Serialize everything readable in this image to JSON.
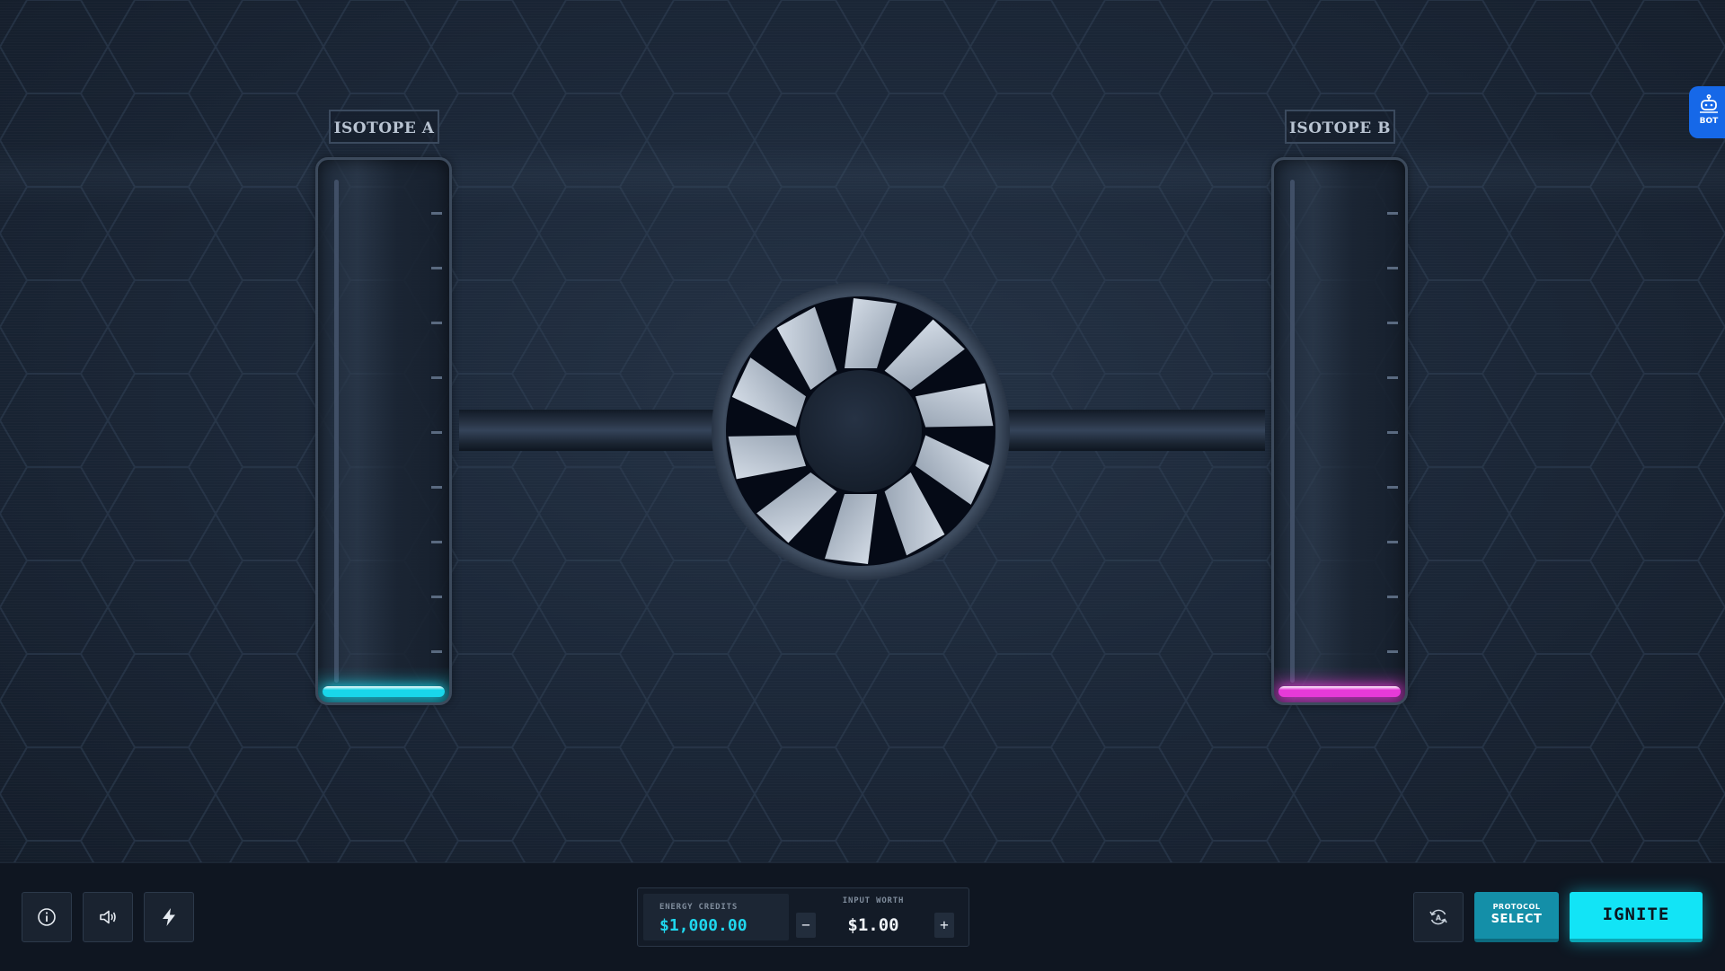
{
  "isotopes": [
    {
      "label": "ISOTOPE A",
      "color": "#19d6ea",
      "level": 0.0
    },
    {
      "label": "ISOTOPE B",
      "color": "#e63ad8",
      "level": 0.0
    }
  ],
  "bot_tab": {
    "label": "BOT",
    "icon": "robot-icon"
  },
  "bottom_bar": {
    "info_icon": "info-icon",
    "sound_icon": "speaker-icon",
    "turbo_icon": "lightning-icon",
    "credits": {
      "label": "ENERGY CREDITS",
      "value": "$1,000.00"
    },
    "input_worth": {
      "label": "INPUT WORTH",
      "value": "$1.00",
      "decrement": "−",
      "increment": "+"
    },
    "autoplay_icon": "auto-rotate-icon",
    "protocol": {
      "top": "PROTOCOL",
      "bottom": "SELECT"
    },
    "ignite": "IGNITE"
  },
  "colors": {
    "accent": "#12e4f6",
    "magenta": "#e63ad8",
    "bot_blue": "#1668e8",
    "protocol": "#148fa8"
  }
}
